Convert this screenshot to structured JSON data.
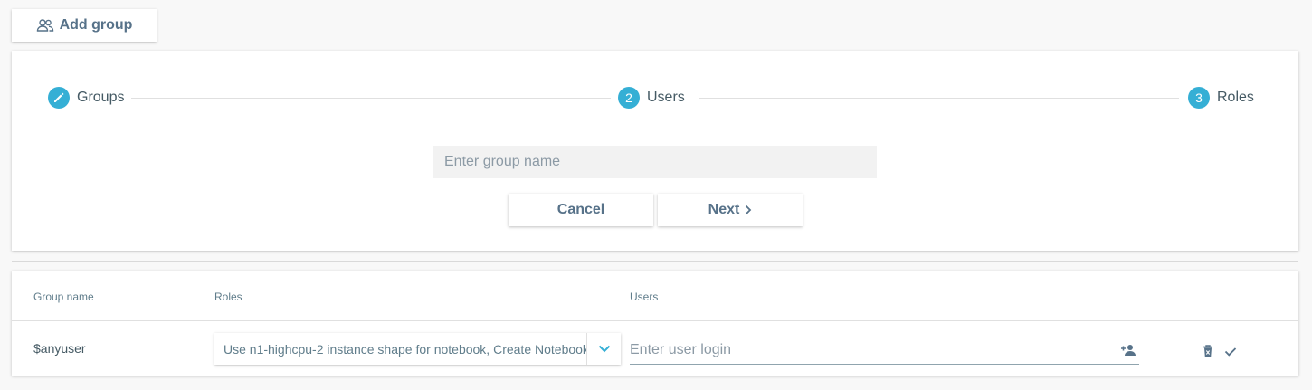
{
  "header": {
    "add_group_label": "Add group",
    "add_group_icon": "group-icon"
  },
  "stepper": {
    "steps": [
      {
        "label": "Groups",
        "marker": "",
        "icon": "pencil-icon"
      },
      {
        "label": "Users",
        "marker": "2"
      },
      {
        "label": "Roles",
        "marker": "3"
      }
    ],
    "accent_color": "#35afd5"
  },
  "form": {
    "group_name_placeholder": "Enter group name",
    "group_name_value": "",
    "cancel_label": "Cancel",
    "next_label": "Next",
    "next_icon": "chevron-right-icon"
  },
  "table": {
    "columns": [
      "Group name",
      "Roles",
      "Users"
    ],
    "rows": [
      {
        "group_name": "$anyuser",
        "roles_value": "Use n1-highcpu-2 instance shape for notebook, Create Notebook",
        "user_placeholder": "Enter user login",
        "icons": [
          "chevron-down-icon",
          "person-add-icon",
          "delete-icon",
          "check-icon"
        ]
      }
    ]
  }
}
